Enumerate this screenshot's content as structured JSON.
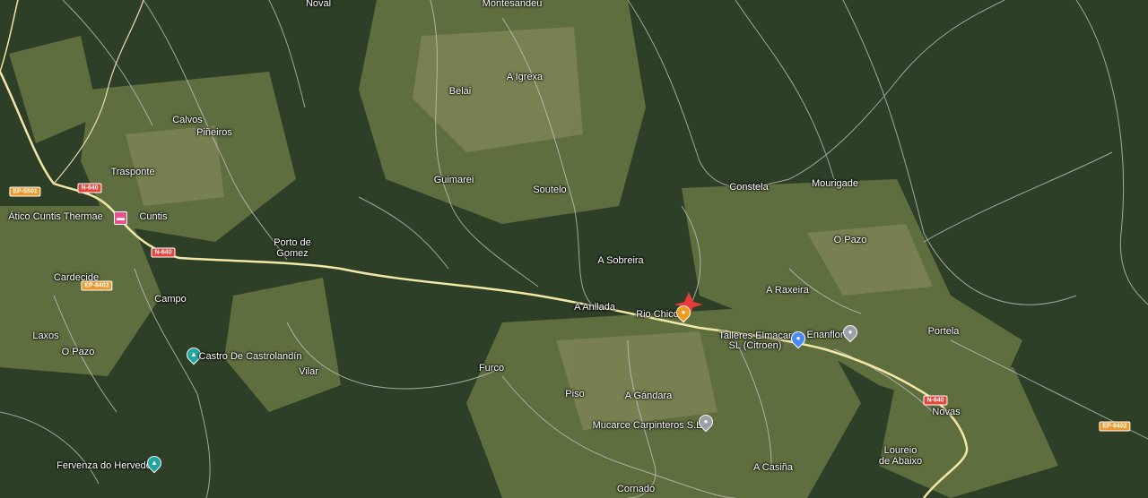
{
  "map": {
    "places": {
      "noval": "Noval",
      "montesandeu": "Montesandeu",
      "a_igrexa": "A Igrexa",
      "belai": "Belai",
      "calvos": "Calvos",
      "pineiros": "Piñeiros",
      "trasponte": "Trasponte",
      "guimarei": "Guimarei",
      "soutelo": "Soutelo",
      "constela": "Constela",
      "mourigade": "Mourigade",
      "cuntis": "Cuntis",
      "porto_de_gomez": "Porto de\nGomez",
      "o_pazo_east": "O Pazo",
      "a_sobreira": "A Sobreira",
      "cardecide": "Cardecide",
      "campo": "Campo",
      "a_raxeira": "A Raxeira",
      "a_anllada": "A Anllada",
      "portela": "Portela",
      "laxos": "Laxos",
      "o_pazo_west": "O Pazo",
      "vilar": "Vilar",
      "furco": "Furco",
      "piso": "Piso",
      "a_gandara": "A Gándara",
      "novas": "Novas",
      "loureiro": "Loureio\nde Abaixo",
      "a_casina": "A Casiña",
      "cornado": "Cornado"
    },
    "pois": {
      "atico": "Ático Cuntis Thermae",
      "rio_chico": "Rio Chico",
      "talleres": "Talleres Elmacar\nSL (Citroen)",
      "enanflor": "Enanflor",
      "castro": "Castro De Castrolandín",
      "mucarce": "Mucarce Carpinteros S.L.",
      "fervenza": "Fervenza do Hervedo"
    },
    "road_shields": {
      "n640_a": "N-640",
      "n640_b": "N-640",
      "n640_c": "N-640",
      "ep5501": "EP-5501",
      "ep8402_a": "EP-8402",
      "ep8402_b": "EP-8402"
    },
    "colors": {
      "forest": "#2d3f27",
      "field": "#6b7a46",
      "road_main": "#f3e7a8",
      "road_minor": "#c9c9c9",
      "marker": "#ea3a3a",
      "lodging": "#e8538a",
      "business": "#4a8af4",
      "park": "#22a7a0",
      "food": "#f29b1a"
    }
  }
}
